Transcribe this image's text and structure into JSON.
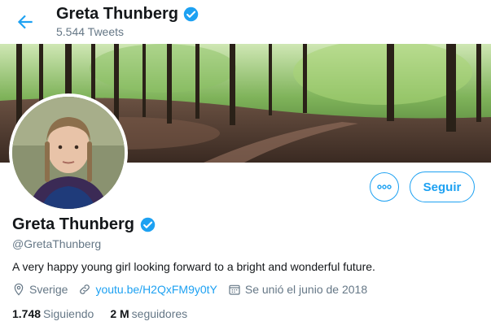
{
  "header": {
    "name": "Greta Thunberg",
    "tweets_count": "5.544 Tweets"
  },
  "profile": {
    "name": "Greta Thunberg",
    "handle": "@GretaThunberg",
    "bio": "A very happy young girl looking forward to a bright and wonderful future.",
    "location": "Sverige",
    "website": "youtu.be/H2QxFM9y0tY",
    "joined": "Se unió el junio de 2018",
    "following_count": "1.748",
    "following_label": "Siguiendo",
    "followers_count": "2 M",
    "followers_label": "seguidores"
  },
  "actions": {
    "follow_label": "Seguir"
  },
  "colors": {
    "accent": "#1da1f2",
    "secondary_text": "#657786"
  },
  "icons": [
    "back-arrow-icon",
    "verified-badge-icon",
    "more-options-icon",
    "location-pin-icon",
    "link-icon",
    "calendar-icon"
  ]
}
